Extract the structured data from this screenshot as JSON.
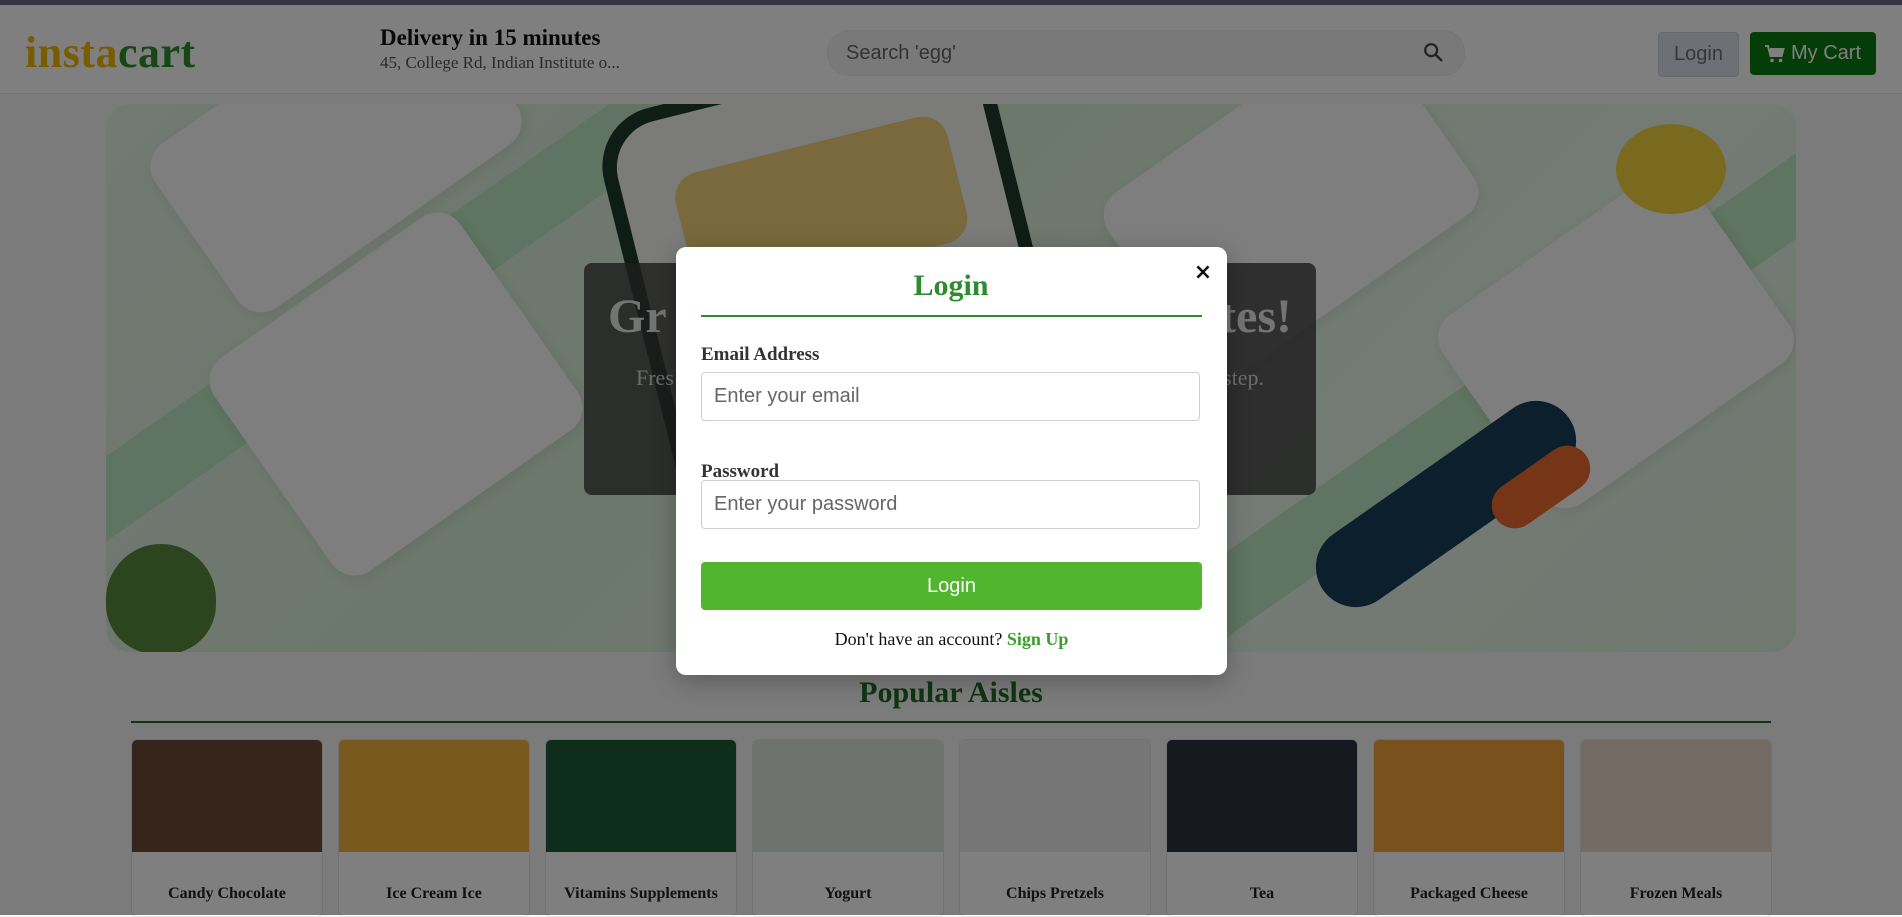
{
  "header": {
    "logo_part1": "insta",
    "logo_part2": "cart",
    "delivery_title": "Delivery in 15 minutes",
    "delivery_address": "45, College Rd, Indian Institute o...",
    "search_placeholder": "Search 'egg'",
    "login_label": "Login",
    "cart_label": "My Cart"
  },
  "hero": {
    "title_start": "Gr",
    "title_end": "tes!",
    "subtitle_start": "Fres",
    "subtitle_end": "step."
  },
  "aisles": {
    "title": "Popular Aisles",
    "items": [
      {
        "name": "Candy Chocolate",
        "color": "#6b4a36"
      },
      {
        "name": "Ice Cream Ice",
        "color": "#f2b23a"
      },
      {
        "name": "Vitamins Supplements",
        "color": "#1f5b3a"
      },
      {
        "name": "Yogurt",
        "color": "#dfe6df"
      },
      {
        "name": "Chips Pretzels",
        "color": "#ededed"
      },
      {
        "name": "Tea",
        "color": "#2d3340"
      },
      {
        "name": "Packaged Cheese",
        "color": "#f2a33a"
      },
      {
        "name": "Frozen Meals",
        "color": "#e9d9c8"
      }
    ]
  },
  "modal": {
    "title": "Login",
    "close_icon": "×",
    "email_label": "Email Address",
    "email_placeholder": "Enter your email",
    "password_label": "Password",
    "password_placeholder": "Enter your password",
    "submit_label": "Login",
    "signup_prompt": "Don't have an account? ",
    "signup_link": "Sign Up"
  },
  "colors": {
    "brand_yellow": "#f2b705",
    "brand_green": "#2f8f2f",
    "cart_green": "#0a7a12",
    "submit_green": "#52b52e"
  }
}
